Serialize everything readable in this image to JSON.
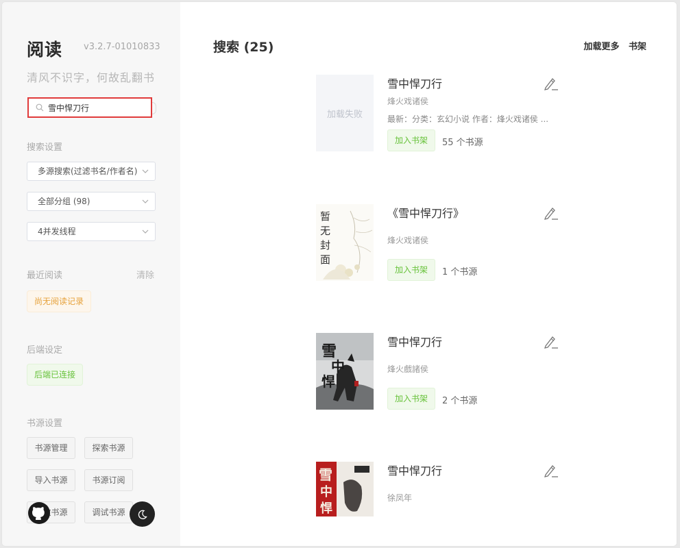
{
  "sidebar": {
    "app_title": "阅读",
    "version": "v3.2.7-01010833",
    "slogan": "清风不识字，何故乱翻书",
    "search_value": "雪中悍刀行",
    "search_settings_label": "搜索设置",
    "selects": [
      "多源搜索(过滤书名/作者名)",
      "全部分组 (98)",
      "4并发线程"
    ],
    "recent_label": "最近阅读",
    "clear_label": "清除",
    "no_history": "尚无阅读记录",
    "backend_label": "后端设定",
    "backend_status": "后端已连接",
    "source_label": "书源设置",
    "source_buttons": [
      "书源管理",
      "探索书源",
      "导入书源",
      "书源订阅",
      "失效书源",
      "调试书源"
    ]
  },
  "main": {
    "title": "搜索 (25)",
    "load_more": "加载更多",
    "bookshelf": "书架",
    "add_label": "加入书架",
    "books": [
      {
        "name": "雪中悍刀行",
        "author": "烽火戏诸侯",
        "intro": "最新：分类：玄幻小说 作者：烽火戏诸侯 ...",
        "cover_text": "加载失败",
        "sources": "55 个书源"
      },
      {
        "name": "《雪中悍刀行》",
        "author": "烽火戏诸侯",
        "intro": "",
        "cover_text": "暂无封面",
        "sources": "1 个书源"
      },
      {
        "name": "雪中悍刀行",
        "author": "烽火戲諸侯",
        "intro": "",
        "cover_text": "",
        "sources": "2 个书源"
      },
      {
        "name": "雪中悍刀行",
        "author": "徐凤年",
        "intro": "",
        "cover_text": "",
        "sources": ""
      }
    ]
  },
  "colors": {
    "accent_green": "#67c23a",
    "warn": "#e6a23c",
    "highlight_red": "#e03a3a"
  }
}
